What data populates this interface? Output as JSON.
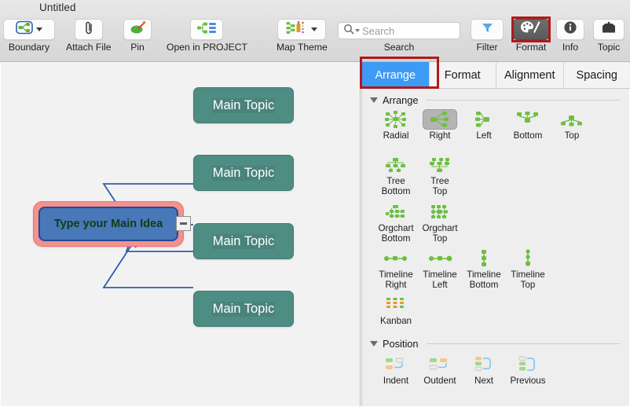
{
  "window": {
    "title": "Untitled"
  },
  "toolbar": {
    "items": [
      {
        "label": "Boundary",
        "icon": "boundary-icon",
        "has_chevron": true
      },
      {
        "label": "Attach File",
        "icon": "paperclip-icon",
        "has_chevron": false
      },
      {
        "label": "Pin",
        "icon": "pin-icon",
        "has_chevron": false
      },
      {
        "label": "Open in PROJECT",
        "icon": "project-icon",
        "has_chevron": false
      },
      {
        "label": "Map Theme",
        "icon": "map-theme-icon",
        "has_chevron": true
      }
    ],
    "search": {
      "group_label": "Search",
      "placeholder": "Search",
      "value": "",
      "icon": "search-icon"
    },
    "right_items": [
      {
        "label": "Filter",
        "icon": "funnel-icon",
        "selected": false
      },
      {
        "label": "Format",
        "icon": "palette-brush-icon",
        "selected": true
      },
      {
        "label": "Info",
        "icon": "info-circle-icon",
        "selected": false
      },
      {
        "label": "Topic",
        "icon": "topic-box-icon",
        "selected": false
      }
    ]
  },
  "annotations": [
    {
      "name": "format-button-highlight",
      "color": "#b01a1a"
    },
    {
      "name": "arrange-tab-highlight",
      "color": "#b01a1a"
    }
  ],
  "canvas": {
    "central_node": {
      "text": "Type your Main Idea",
      "fill": "#4878b8",
      "border": "#1f4b96",
      "halo": "#f4908d",
      "text_color": "#123b16"
    },
    "collapse_button": {
      "glyph": "minus"
    },
    "topics": [
      {
        "text": "Main Topic"
      },
      {
        "text": "Main Topic"
      },
      {
        "text": "Main Topic"
      },
      {
        "text": "Main Topic"
      }
    ],
    "topic_style": {
      "fill": "#4e8d83",
      "text_color": "#ffffff"
    },
    "link_color": "#2d5fa8",
    "background": "#f2f2f2"
  },
  "panel": {
    "tabs": [
      {
        "label": "Arrange",
        "active": true
      },
      {
        "label": "Format",
        "active": false
      },
      {
        "label": "Alignment",
        "active": false
      },
      {
        "label": "Spacing",
        "active": false
      }
    ],
    "sections": [
      {
        "title": "Arrange",
        "items": [
          {
            "label": "Radial",
            "icon": "radial-layout-icon",
            "selected": false
          },
          {
            "label": "Right",
            "icon": "right-layout-icon",
            "selected": true
          },
          {
            "label": "Left",
            "icon": "left-layout-icon",
            "selected": false
          },
          {
            "label": "Bottom",
            "icon": "bottom-layout-icon",
            "selected": false
          },
          {
            "label": "Top",
            "icon": "top-layout-icon",
            "selected": false
          },
          {
            "label": "Tree\nBottom",
            "icon": "tree-bottom-icon",
            "selected": false
          },
          {
            "label": "Tree\nTop",
            "icon": "tree-top-icon",
            "selected": false
          },
          {
            "label": "Orgchart\nBottom",
            "icon": "orgchart-bottom-icon",
            "selected": false
          },
          {
            "label": "Orgchart\nTop",
            "icon": "orgchart-top-icon",
            "selected": false
          },
          {
            "label": "Timeline\nRight",
            "icon": "timeline-right-icon",
            "selected": false
          },
          {
            "label": "Timeline\nLeft",
            "icon": "timeline-left-icon",
            "selected": false
          },
          {
            "label": "Timeline\nBottom",
            "icon": "timeline-bottom-icon",
            "selected": false
          },
          {
            "label": "Timeline\nTop",
            "icon": "timeline-top-icon",
            "selected": false
          },
          {
            "label": "Kanban",
            "icon": "kanban-icon",
            "selected": false
          }
        ]
      },
      {
        "title": "Position",
        "items": [
          {
            "label": "Indent",
            "icon": "indent-icon",
            "selected": false
          },
          {
            "label": "Outdent",
            "icon": "outdent-icon",
            "selected": false
          },
          {
            "label": "Next",
            "icon": "next-icon",
            "selected": false
          },
          {
            "label": "Previous",
            "icon": "previous-icon",
            "selected": false
          }
        ]
      }
    ]
  }
}
